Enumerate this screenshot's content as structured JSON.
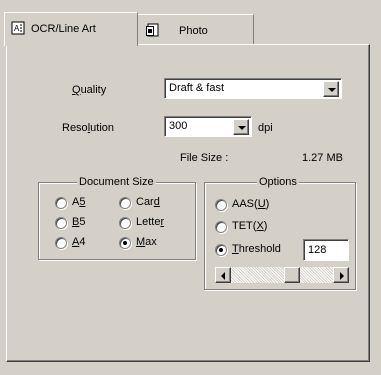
{
  "tabs": [
    {
      "label": "OCR/Line Art",
      "icon": "ocr-document-icon",
      "active": true
    },
    {
      "label": "Photo",
      "icon": "photo-document-icon",
      "active": false
    }
  ],
  "quality": {
    "label": "Quality",
    "value": "Draft & fast"
  },
  "resolution": {
    "label": "Resolution",
    "value": "300",
    "unit": "dpi"
  },
  "file_size": {
    "label": "File Size :",
    "value": "1.27 MB"
  },
  "document_size": {
    "title": "Document Size",
    "options": [
      "A5",
      "Card",
      "B5",
      "Letter",
      "A4",
      "Max"
    ],
    "selected": "Max"
  },
  "options": {
    "title": "Options",
    "items": [
      "AAS(U)",
      "TET(X)",
      "Threshold"
    ],
    "selected": "Threshold",
    "threshold_value": "128",
    "slider_level": 0.62
  }
}
